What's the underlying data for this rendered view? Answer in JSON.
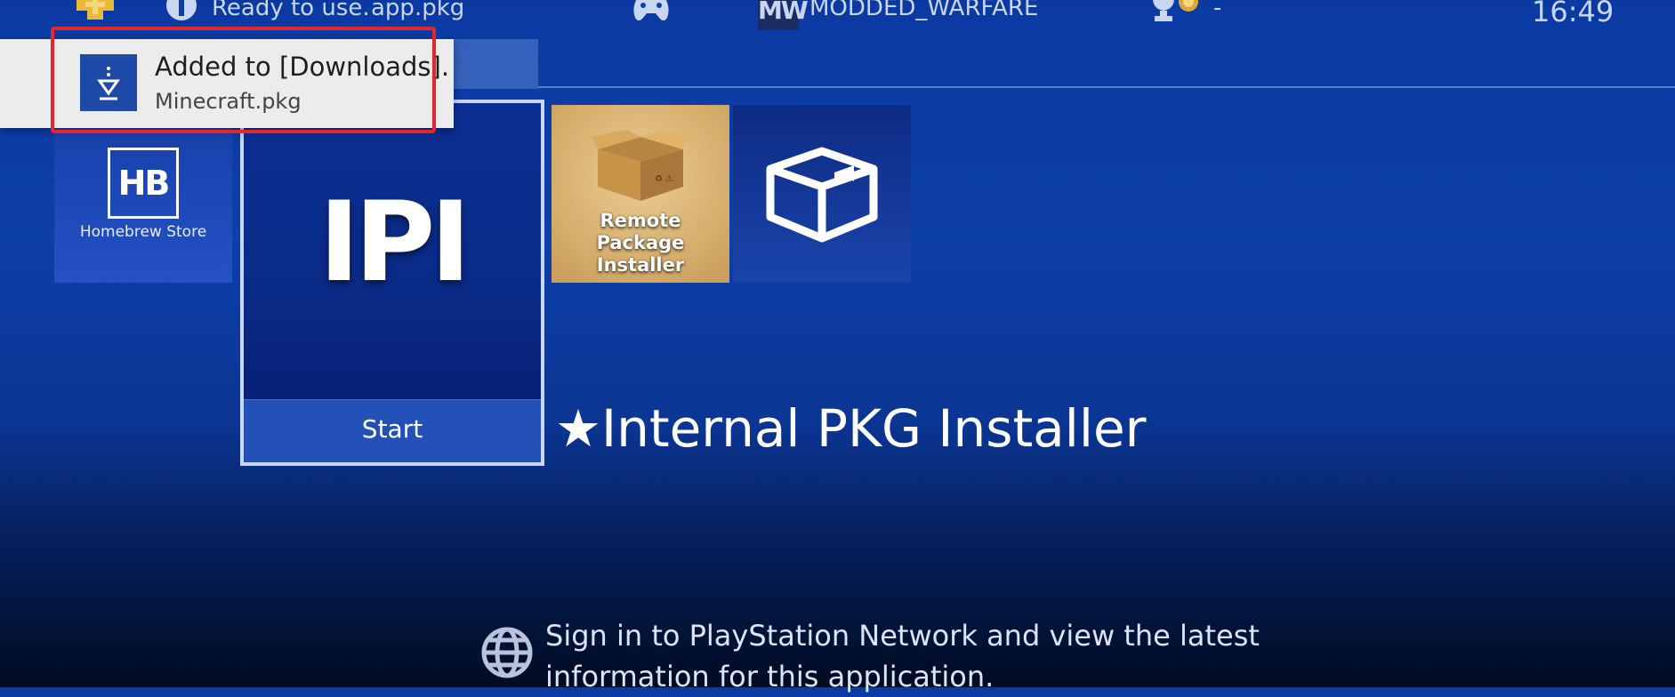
{
  "status_bar": {
    "info_text": "Ready to use.",
    "info_file": "app.pkg",
    "game_badge": "MW",
    "game_name": "MODDED_WARFARE",
    "trophy_text": "-",
    "time": "16:49",
    "icons": [
      "ps-plus-icon",
      "info-icon",
      "gamepad-icon",
      "trophy-icon"
    ]
  },
  "notification": {
    "title": "Added to [Downloads].",
    "subtitle": "Minecraft.pkg",
    "icon": "download-icon"
  },
  "tiles": {
    "homebrew": {
      "logo": "HB",
      "label": "Homebrew Store"
    },
    "ipi": {
      "logo": "IPI",
      "action_label": "Start"
    },
    "rpi": {
      "label_line1": "Remote",
      "label_line2": "Package Installer"
    },
    "package": {
      "icon": "package-box-icon"
    }
  },
  "focused_app": {
    "title": "★Internal PKG Installer"
  },
  "info_panel": {
    "line1": "Sign in to PlayStation Network and view the latest",
    "line2": "information for this application.",
    "icon": "globe-icon"
  },
  "colors": {
    "background": "#0d3fa8",
    "highlight_border": "#e5262c",
    "toast_bg": "#ececec",
    "rpi_tile": "#d9b272"
  }
}
